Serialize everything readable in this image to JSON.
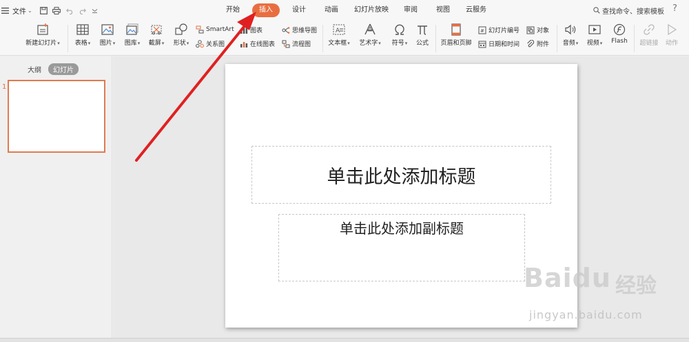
{
  "menu": {
    "file_label": "文件",
    "tabs": [
      {
        "label": "开始",
        "active": false
      },
      {
        "label": "插入",
        "active": true
      },
      {
        "label": "设计",
        "active": false
      },
      {
        "label": "动画",
        "active": false
      },
      {
        "label": "幻灯片放映",
        "active": false
      },
      {
        "label": "审阅",
        "active": false
      },
      {
        "label": "视图",
        "active": false
      },
      {
        "label": "云服务",
        "active": false
      }
    ],
    "search_text": "查找命令、搜索模板",
    "help_label": "?"
  },
  "ribbon": {
    "new_slide": "新建幻灯片",
    "table": "表格",
    "picture": "图片",
    "gallery": "图库",
    "screenshot": "截屏",
    "shape": "形状",
    "smartart": "SmartArt",
    "relation": "关系图",
    "chart": "图表",
    "online_chart": "在线图表",
    "mindmap": "思维导图",
    "flowchart": "流程图",
    "textbox": "文本框",
    "wordart": "艺术字",
    "symbol": "符号",
    "formula": "公式",
    "header_footer": "页眉和页脚",
    "slide_number": "幻灯片编号",
    "object": "对象",
    "datetime": "日期和时间",
    "attachment": "附件",
    "audio": "音频",
    "video": "视频",
    "flash": "Flash",
    "hyperlink": "超链接",
    "action": "动作"
  },
  "leftpane": {
    "tab_outline": "大纲",
    "tab_slides": "幻灯片",
    "slide_number": "1"
  },
  "slide": {
    "title_placeholder": "单击此处添加标题",
    "subtitle_placeholder": "单击此处添加副标题"
  },
  "watermark": {
    "logo": "Baidu",
    "cn": "经验",
    "url": "jingyan.baidu.com"
  },
  "colors": {
    "accent": "#e86e41",
    "arrow": "#e02020"
  }
}
